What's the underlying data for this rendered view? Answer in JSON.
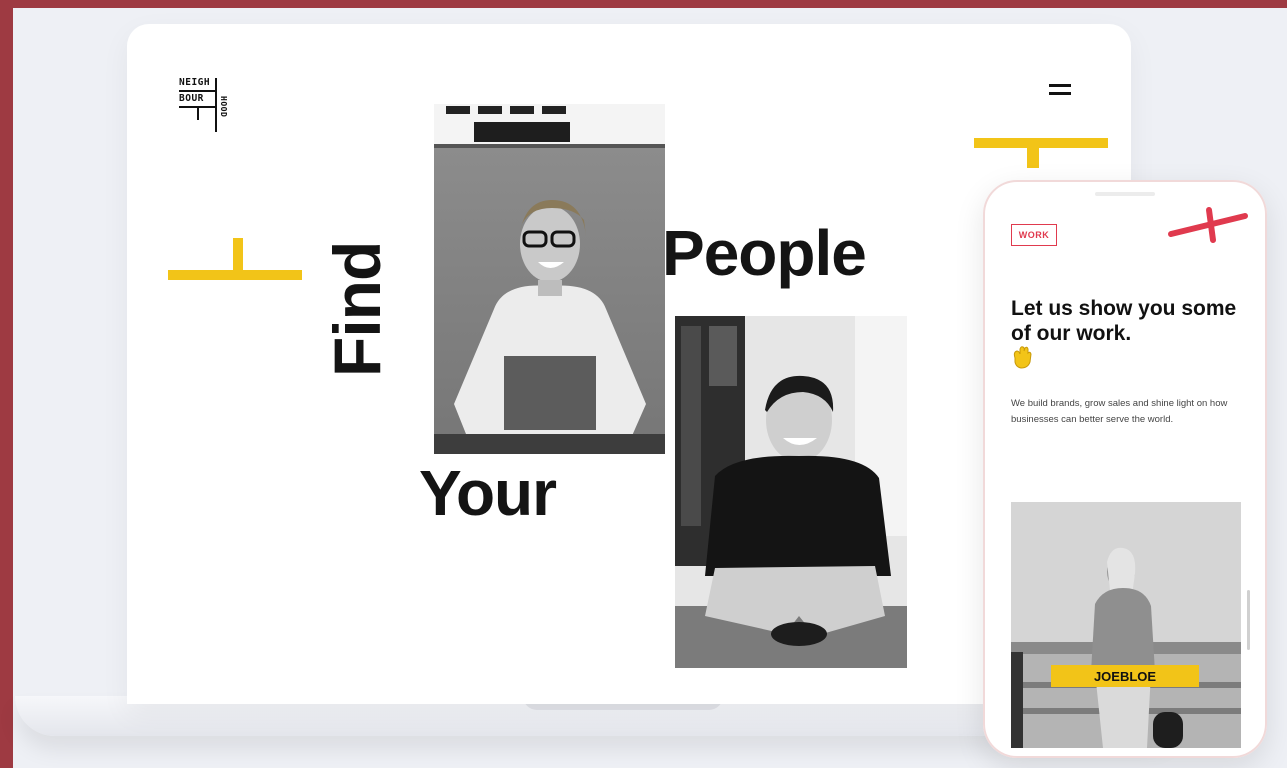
{
  "laptop": {
    "logo": {
      "line1": "NEIGH",
      "line2": "BOUR",
      "line3": "HOOD"
    },
    "menu_icon": "hamburger-icon",
    "hero_words": {
      "people": "People",
      "find": "Find",
      "your": "Your"
    }
  },
  "phone": {
    "badge": "WORK",
    "headline": "Let us show you some of our work.",
    "wave_icon": "waving-hand-icon",
    "body": "We build brands, grow sales and shine light on how businesses can better serve the world.",
    "project_label": "JOEBLOE"
  },
  "colors": {
    "accent_yellow": "#f2c418",
    "accent_red": "#e03a4e",
    "frame": "#9e3a42"
  }
}
